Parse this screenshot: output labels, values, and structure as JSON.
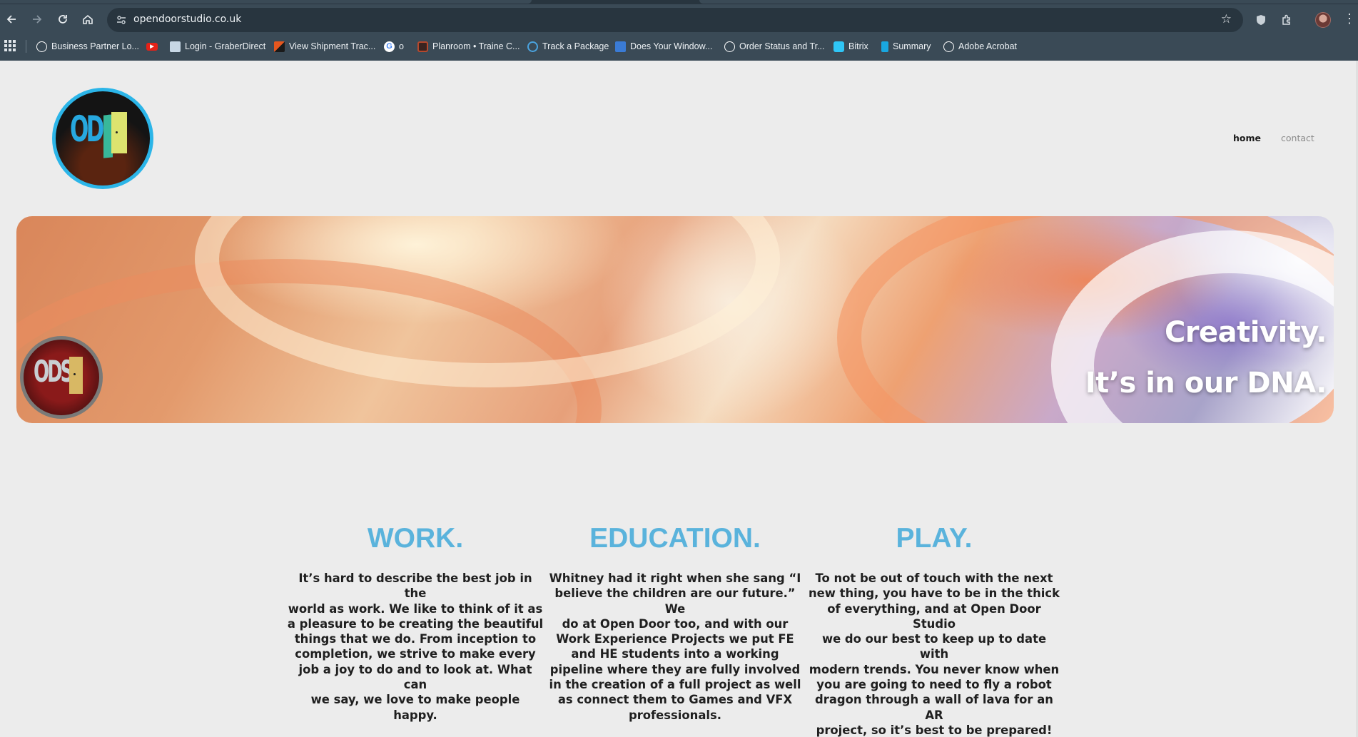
{
  "browser": {
    "url": "opendoorstudio.co.uk",
    "bookmarks": [
      {
        "label": "Business Partner Lo...",
        "icon": "globe-icon",
        "color": "#ffffff"
      },
      {
        "label": "",
        "icon": "youtube-icon",
        "color": "#e62117"
      },
      {
        "label": "Login - GraberDirect",
        "icon": "document-icon",
        "color": "#c7d7e5"
      },
      {
        "label": "View Shipment Trac...",
        "icon": "shipping-icon",
        "color": "#e4561e"
      },
      {
        "label": "o",
        "icon": "google-icon",
        "color": "#4285f4"
      },
      {
        "label": "Planroom • Traine C...",
        "icon": "planroom-icon",
        "color": "#b5482d"
      },
      {
        "label": "Track a Package",
        "icon": "track-icon",
        "color": "#4aa3df"
      },
      {
        "label": "Does Your Window...",
        "icon": "search-doc-icon",
        "color": "#3a7bd5"
      },
      {
        "label": "Order Status and Tr...",
        "icon": "globe-icon",
        "color": "#ffffff"
      },
      {
        "label": "Bitrix",
        "icon": "bitrix-icon",
        "color": "#2fc6f6"
      },
      {
        "label": "Summary",
        "icon": "summary-icon",
        "color": "#19a7e0"
      },
      {
        "label": "Adobe Acrobat",
        "icon": "globe-icon",
        "color": "#ffffff"
      }
    ]
  },
  "site": {
    "logo_text": "ODS",
    "nav": {
      "home": "home",
      "contact": "contact"
    },
    "hero": {
      "badge_text": "ODS",
      "line1": "Creativity.",
      "line2": "It’s in our DNA."
    },
    "columns": [
      {
        "title": "WORK.",
        "lines": [
          "It’s hard to describe the best job in the",
          "world as work. We like to think of it as",
          "a pleasure to be creating the beautiful",
          "things that we do. From inception to",
          "completion, we strive to make every",
          "job a joy to do and to look at. What can",
          "we say, we love to make people happy."
        ]
      },
      {
        "title": "EDUCATION.",
        "lines": [
          "Whitney had it right when she sang “I",
          "believe the children are our future.” We",
          "do at Open Door too, and with our",
          "Work Experience Projects we put FE",
          "and HE students into a working",
          "pipeline where they are fully involved",
          "in the creation of a full project as well",
          "as connect them to Games and VFX",
          "professionals."
        ]
      },
      {
        "title": "PLAY.",
        "lines": [
          "To not be out of touch with the next",
          "new thing, you have to be in the thick",
          "of everything, and at Open Door Studio",
          "we do our best to keep up to date with",
          "modern trends. You never know when",
          "you are going to need to fly a robot",
          "dragon through a wall of lava for an AR",
          "project, so it’s best to be prepared!"
        ]
      }
    ]
  },
  "colors": {
    "accent": "#5ab3dc",
    "chrome": "#3a4a56",
    "page_bg": "#ececec"
  }
}
